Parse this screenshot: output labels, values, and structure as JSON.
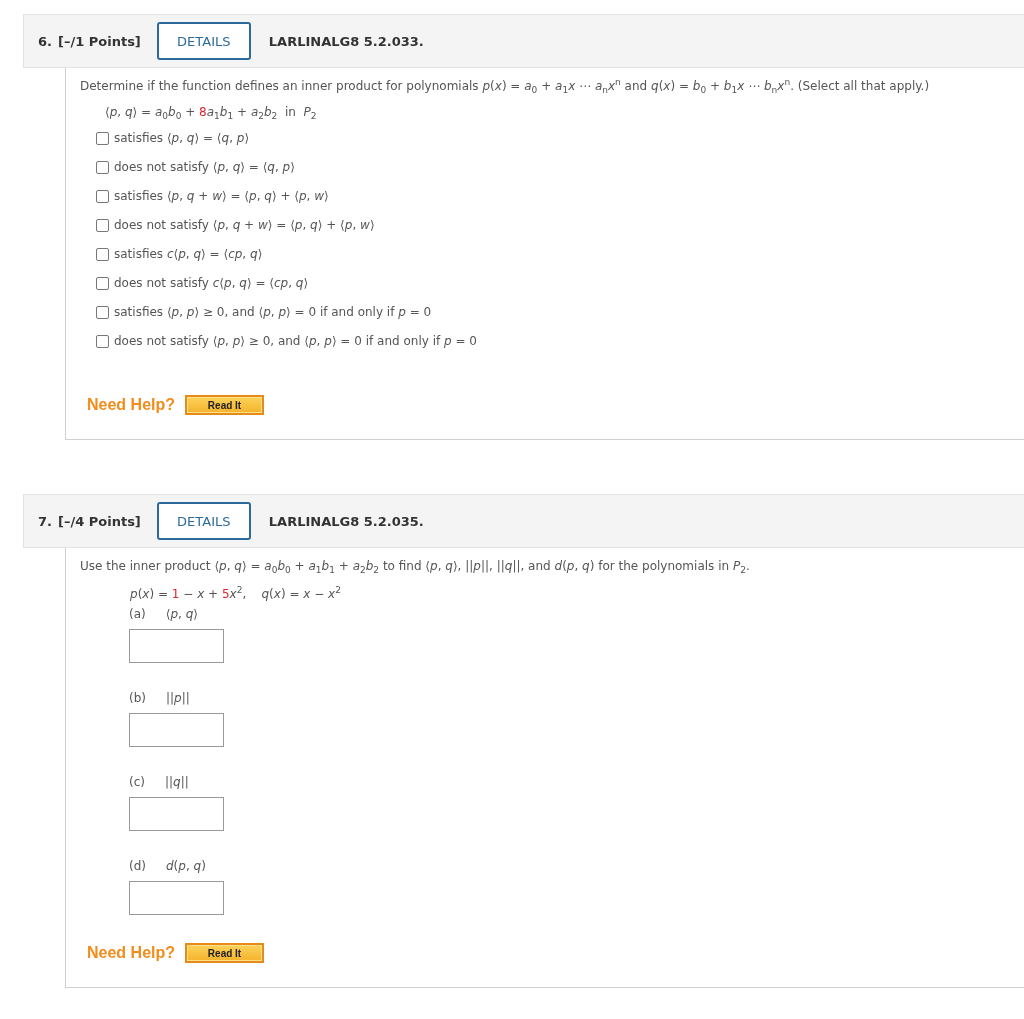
{
  "questions": [
    {
      "number": "6.",
      "points": "[–/1 Points]",
      "details": "DETAILS",
      "code": "LARLINALG8 5.2.033.",
      "prompt": "Determine if the function defines an inner product for polynomials  *p*(*x*) = *a*$_{0}$ + *a*$_{1}$*x* ⋯ *a*$_{n}$*x*$^{n}$ and *q*(*x*) = *b*$_{0}$ + *b*$_{1}$*x* ⋯ *b*$_{n}$*x*$^{n}$.  (Select all that apply.)",
      "formula": [
        {
          "text": "⟨*p*, *q*⟩ = *a*$_{0}$*b*$_{0}$ + ",
          "highlight": false
        },
        {
          "text": "8",
          "highlight": true
        },
        {
          "text": "*a*$_{1}$*b*$_{1}$ + *a*$_{2}$*b*$_{2}$  in  *P*$_{2}$",
          "highlight": false
        }
      ],
      "options": [
        {
          "label": "satisfies ⟨*p*, *q*⟩ = ⟨*q*, *p*⟩",
          "checked": false
        },
        {
          "label": "does not satisfy ⟨*p*, *q*⟩ = ⟨*q*, *p*⟩",
          "checked": false
        },
        {
          "label": "satisfies ⟨*p*, *q* + *w*⟩ = ⟨*p*, *q*⟩ + ⟨*p*, *w*⟩",
          "checked": false
        },
        {
          "label": "does not satisfy ⟨*p*, *q* + *w*⟩ = ⟨*p*, *q*⟩ + ⟨*p*, *w*⟩",
          "checked": false
        },
        {
          "label": "satisfies *c*⟨*p*, *q*⟩ = ⟨*cp*, *q*⟩",
          "checked": false
        },
        {
          "label": "does not satisfy *c*⟨*p*, *q*⟩ = ⟨*cp*, *q*⟩",
          "checked": false
        },
        {
          "label": "satisfies ⟨*p*, *p*⟩ ≥ 0, and ⟨*p*, *p*⟩ = 0 if and only if *p* = 0",
          "checked": false
        },
        {
          "label": "does not satisfy ⟨*p*, *p*⟩ ≥ 0, and ⟨*p*, *p*⟩ = 0 if and only if *p* = 0",
          "checked": false
        }
      ],
      "help": "Need Help?",
      "read": "Read It"
    },
    {
      "number": "7.",
      "points": "[–/4 Points]",
      "details": "DETAILS",
      "code": "LARLINALG8 5.2.035.",
      "prompt": "Use the inner product  ⟨*p*, *q*⟩ = *a*$_{0}$*b*$_{0}$ + *a*$_{1}$*b*$_{1}$ + *a*$_{2}$*b*$_{2}$  to find  ⟨*p*, *q*⟩, ||*p*||, ||*q*||, and *d*(*p*, *q*)  for the polynomials in *P*$_{2}$.",
      "formula": [
        {
          "text": "*p*(*x*) = ",
          "highlight": false
        },
        {
          "text": "1",
          "highlight": true
        },
        {
          "text": " − *x* + ",
          "highlight": false
        },
        {
          "text": "5",
          "highlight": true
        },
        {
          "text": "*x*$^{2}$,    *q*(*x*) = *x* − *x*$^{2}$",
          "highlight": false
        }
      ],
      "parts": [
        {
          "label": "(a)",
          "expr": "⟨*p*, *q*⟩"
        },
        {
          "label": "(b)",
          "expr": "||*p*||"
        },
        {
          "label": "(c)",
          "expr": "||*q*||"
        },
        {
          "label": "(d)",
          "expr": "*d*(*p*, *q*)"
        }
      ],
      "help": "Need Help?",
      "read": "Read It"
    }
  ]
}
